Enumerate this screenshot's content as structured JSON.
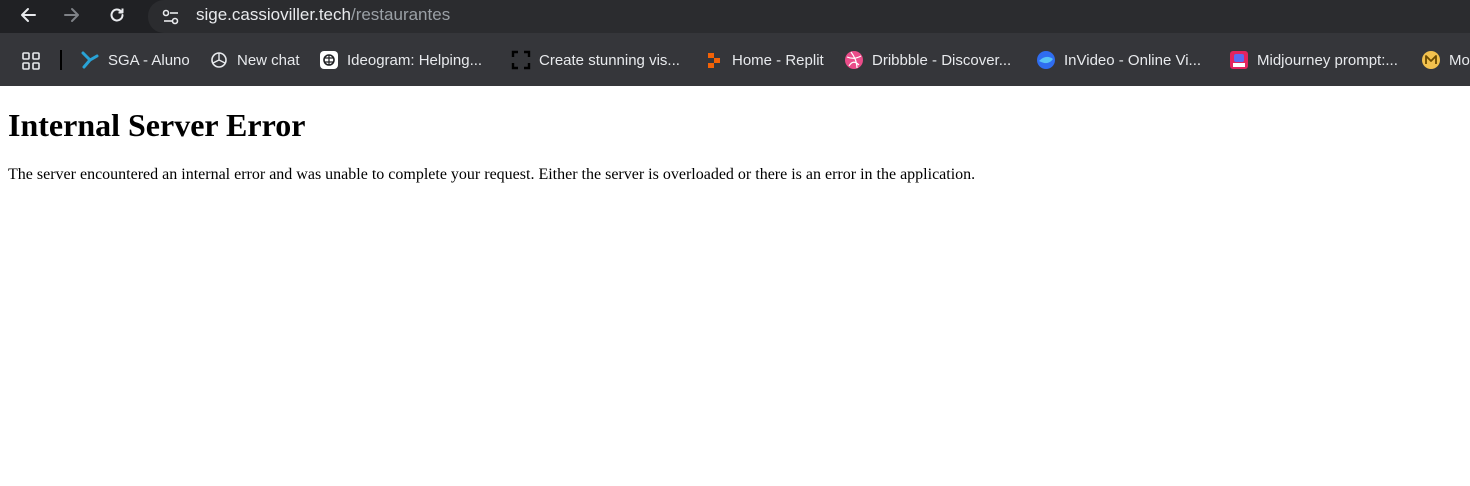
{
  "browser": {
    "url_host": "sige.cassioviller.tech",
    "url_path": "/restaurantes"
  },
  "bookmarks": [
    {
      "label": "SGA - Aluno",
      "icon": "sga-icon"
    },
    {
      "label": "New chat",
      "icon": "openai-icon"
    },
    {
      "label": "Ideogram: Helping...",
      "icon": "ideogram-icon"
    },
    {
      "label": "Create stunning vis...",
      "icon": "frame-icon"
    },
    {
      "label": "Home - Replit",
      "icon": "replit-icon"
    },
    {
      "label": "Dribbble - Discover...",
      "icon": "dribbble-icon"
    },
    {
      "label": "InVideo - Online Vi...",
      "icon": "invideo-icon"
    },
    {
      "label": "Midjourney prompt:...",
      "icon": "midjourney-icon"
    },
    {
      "label": "Mo",
      "icon": "m-coin-icon"
    }
  ],
  "page": {
    "title": "Internal Server Error",
    "message": "The server encountered an internal error and was unable to complete your request. Either the server is overloaded or there is an error in the application."
  }
}
